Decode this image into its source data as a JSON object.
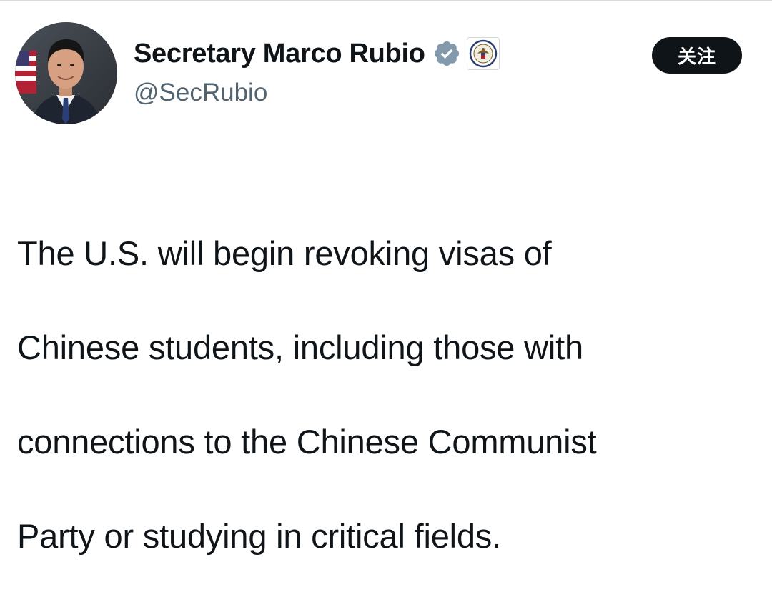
{
  "author": {
    "display_name": "Secretary Marco Rubio",
    "handle": "@SecRubio",
    "verified_badge_icon": "verified-badge-icon",
    "verified_badge_color": "#829aab",
    "affiliation_badge_icon": "state-department-seal-icon"
  },
  "follow_button": {
    "label": "关注",
    "background": "#0f1419",
    "color": "#ffffff"
  },
  "tweet": {
    "lines": [
      "The U.S. will begin revoking visas of",
      "Chinese students, including those with",
      "connections to the Chinese Communist",
      "Party or studying in critical fields."
    ]
  },
  "colors": {
    "text_primary": "#0f1419",
    "text_secondary": "#536471"
  }
}
